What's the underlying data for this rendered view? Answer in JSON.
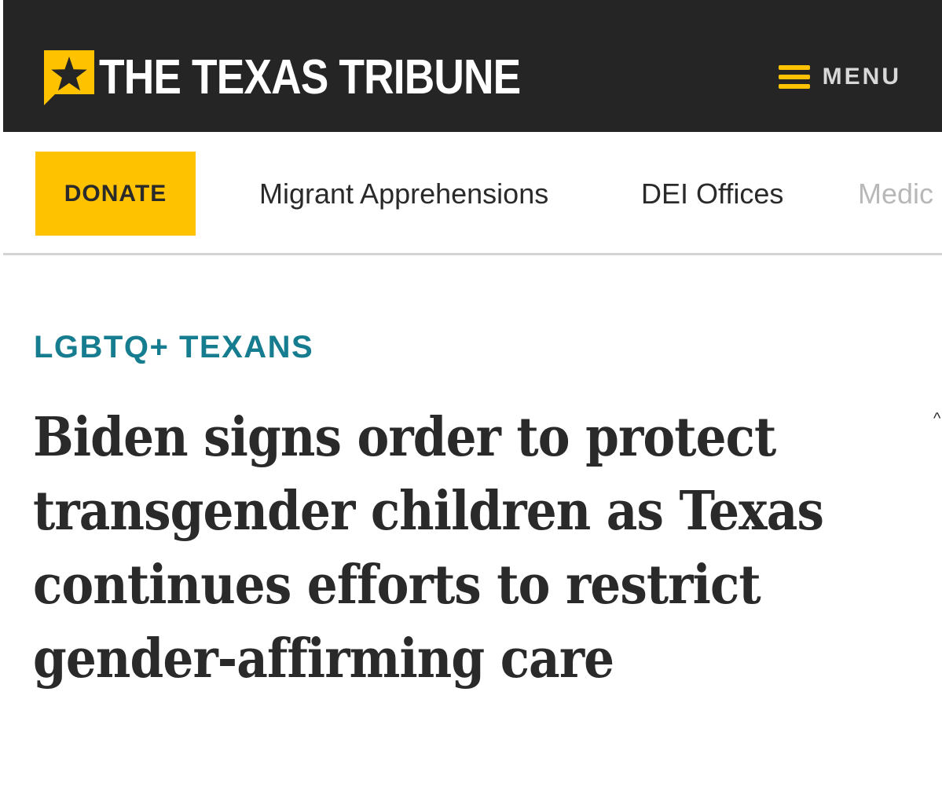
{
  "header": {
    "logo_text": "THE TEXAS TRIBUNE",
    "menu_label": "MENU",
    "colors": {
      "background": "#252525",
      "accent": "#ffc200"
    }
  },
  "subnav": {
    "donate_label": "DONATE",
    "links": [
      "Migrant Apprehensions",
      "DEI Offices",
      "Medic"
    ]
  },
  "article": {
    "kicker": "LGBTQ+ TEXANS",
    "kicker_color": "#157d8f",
    "headline": "Biden signs order to protect transgender children as Texas continues efforts to restrict gender-affirming care"
  },
  "icons": {
    "logo": "star-speech-bubble-icon",
    "menu": "hamburger-icon"
  }
}
